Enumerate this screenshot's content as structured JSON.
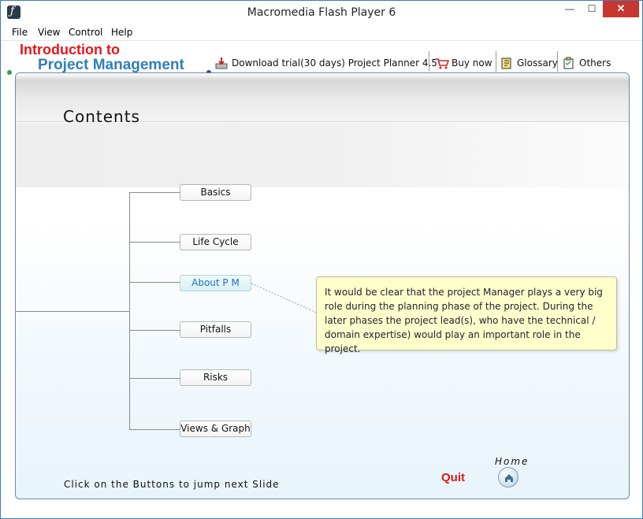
{
  "window": {
    "title": "Macromedia Flash Player 6",
    "controls": {
      "minimize": "—",
      "maximize": "☐",
      "close": "✕"
    }
  },
  "menu": [
    "File",
    "View",
    "Control",
    "Help"
  ],
  "header": {
    "brand_line1": "Introduction to",
    "brand_line2": "Project Management"
  },
  "toolbar": {
    "download": "Download trial(30 days) Project Planner 4.5",
    "buy": "Buy now",
    "glossary": "Glossary",
    "others": "Others"
  },
  "stage": {
    "title": "Contents",
    "nodes": [
      "Basics",
      "Life Cycle",
      "About P M",
      "Pitfalls",
      "Risks",
      "Views & Graph"
    ],
    "active_node": "About P M",
    "tooltip": "It would be clear that the project Manager plays a very big role during the planning phase of the project. During the later phases the project lead(s), who have the technical / domain expertise) would play an important role in the project.",
    "hint": "Click on the Buttons to jump next Slide",
    "quit": "Quit",
    "home": "Home"
  },
  "colors": {
    "brand_red": "#e8161c",
    "brand_blue": "#2f7fb8",
    "tooltip_bg": "#ffffcc",
    "active_node_text": "#1f6fc2",
    "close_button": "#c7372f"
  }
}
